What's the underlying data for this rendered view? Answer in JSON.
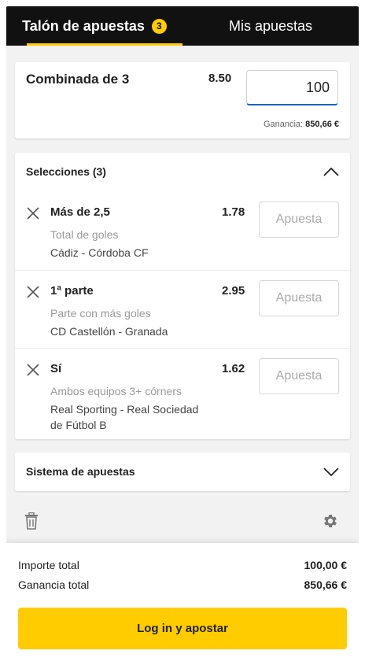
{
  "tabs": {
    "betslip_label": "Talón de apuestas",
    "betslip_count": "3",
    "my_bets_label": "Mis apuestas"
  },
  "combo": {
    "title": "Combinada de 3",
    "odds": "8.50",
    "stake_value": "100",
    "gain_label": "Ganancia:",
    "gain_value": "850,66 €"
  },
  "selections": {
    "header": "Selecciones (3)",
    "stake_placeholder": "Apuesta",
    "items": [
      {
        "pick": "Más de 2,5",
        "market": "Total de goles",
        "event": "Cádiz - Córdoba CF",
        "odds": "1.78"
      },
      {
        "pick": "1ª parte",
        "market": "Parte con más goles",
        "event": "CD Castellón - Granada",
        "odds": "2.95"
      },
      {
        "pick": "Sí",
        "market": "Ambos equipos 3+ córners",
        "event": "Real Sporting - Real Sociedad de Fútbol B",
        "odds": "1.62"
      }
    ]
  },
  "system": {
    "title": "Sistema de apuestas"
  },
  "icons": {
    "remove": "close-icon",
    "collapse": "chevron-up-icon",
    "expand": "chevron-down-icon",
    "delete": "trash-icon",
    "settings": "gear-icon"
  },
  "summary": {
    "total_stake_label": "Importe total",
    "total_stake_value": "100,00 €",
    "total_gain_label": "Ganancia total",
    "total_gain_value": "850,66 €"
  },
  "cta": {
    "label": "Log in y apostar"
  },
  "colors": {
    "accent": "#ffcc00",
    "header_bg": "#111111",
    "input_focus": "#1565c0"
  }
}
